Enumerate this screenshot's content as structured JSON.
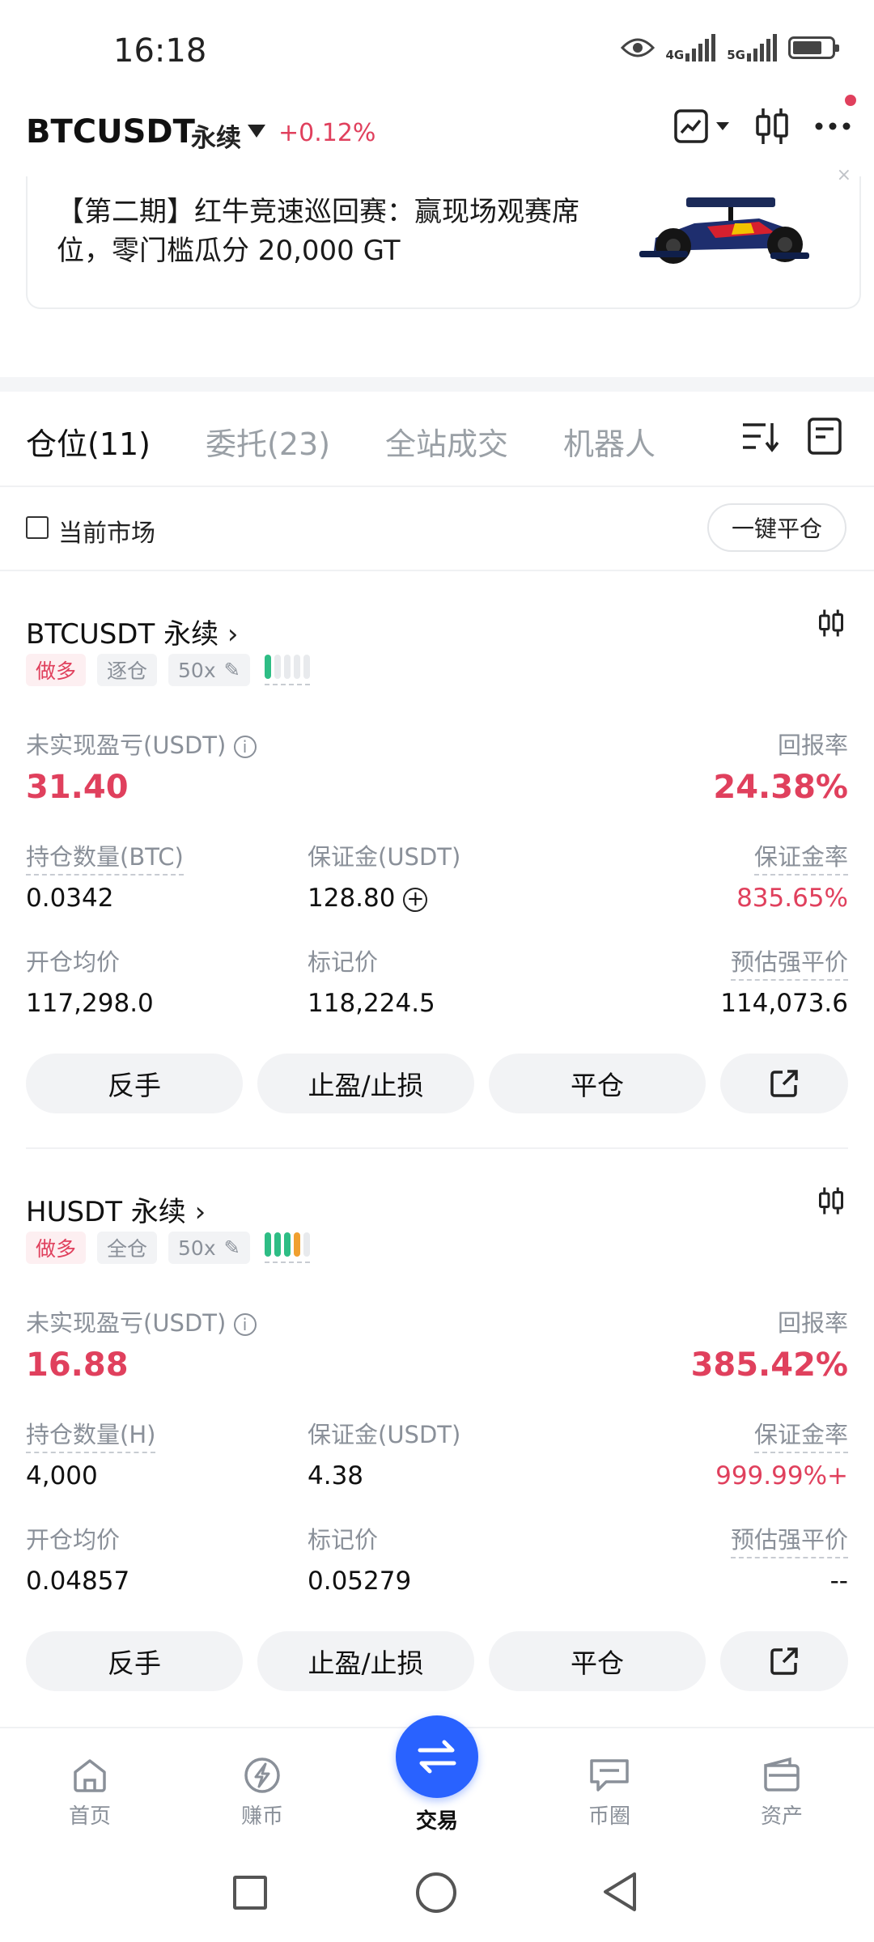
{
  "status_bar": {
    "time": "16:18",
    "net1": "4G",
    "net2": "5G",
    "battery_level": 0.75
  },
  "header": {
    "symbol": "BTCUSDT",
    "contract": "永续",
    "change": "+0.12%"
  },
  "banner": {
    "text": "【第二期】红牛竞速巡回赛：赢现场观赛席位，零门槛瓜分 20,000 GT",
    "close": "×"
  },
  "tabs": [
    {
      "label": "仓位(11)"
    },
    {
      "label": "委托(23)"
    },
    {
      "label": "全站成交"
    },
    {
      "label": "机器人"
    }
  ],
  "filter": {
    "checkbox_label": "当前市场",
    "close_all": "一键平仓"
  },
  "positions": [
    {
      "title": "BTCUSDT 永续",
      "side": "做多",
      "margin_mode": "逐仓",
      "leverage": "50x",
      "risk_bars": [
        "g",
        "",
        "",
        "",
        ""
      ],
      "pnl_label": "未实现盈亏(USDT)",
      "pnl": "31.40",
      "roe_label": "回报率",
      "roe": "24.38%",
      "size_label": "持仓数量(BTC)",
      "size": "0.0342",
      "margin_label": "保证金(USDT)",
      "margin": "128.80",
      "margin_ratio_label": "保证金率",
      "margin_ratio": "835.65%",
      "entry_label": "开仓均价",
      "entry": "117,298.0",
      "mark_label": "标记价",
      "mark": "118,224.5",
      "liq_label": "预估强平价",
      "liq": "114,073.6",
      "buttons": {
        "reverse": "反手",
        "tpsl": "止盈/止损",
        "close": "平仓"
      }
    },
    {
      "title": "HUSDT 永续",
      "side": "做多",
      "margin_mode": "全仓",
      "leverage": "50x",
      "risk_bars": [
        "g",
        "g",
        "g",
        "o",
        ""
      ],
      "pnl_label": "未实现盈亏(USDT)",
      "pnl": "16.88",
      "roe_label": "回报率",
      "roe": "385.42%",
      "size_label": "持仓数量(H)",
      "size": "4,000",
      "margin_label": "保证金(USDT)",
      "margin": "4.38",
      "margin_ratio_label": "保证金率",
      "margin_ratio": "999.99%+",
      "entry_label": "开仓均价",
      "entry": "0.04857",
      "mark_label": "标记价",
      "mark": "0.05279",
      "liq_label": "预估强平价",
      "liq": "--",
      "buttons": {
        "reverse": "反手",
        "tpsl": "止盈/止损",
        "close": "平仓"
      }
    }
  ],
  "bottom_nav": [
    {
      "label": "首页",
      "icon": "home-icon"
    },
    {
      "label": "赚币",
      "icon": "earn-icon"
    },
    {
      "label": "交易",
      "icon": "swap-arrows-icon"
    },
    {
      "label": "币圈",
      "icon": "chat-icon"
    },
    {
      "label": "资产",
      "icon": "wallet-icon"
    }
  ],
  "colors": {
    "red": "#e0405d",
    "green": "#2ebd85",
    "blue": "#2962ff",
    "orange": "#f0a030"
  }
}
